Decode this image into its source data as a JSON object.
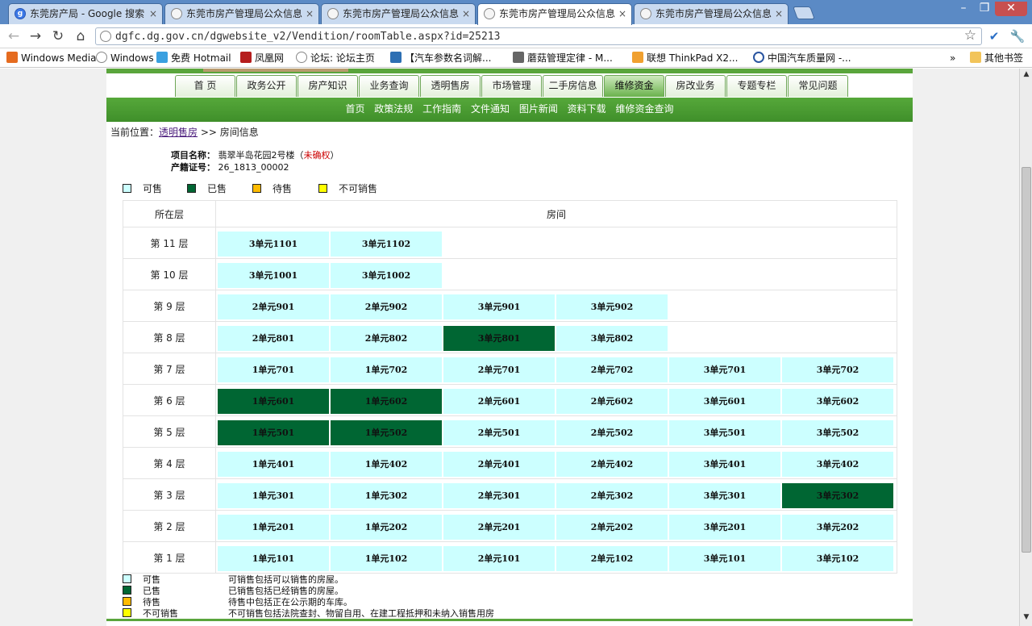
{
  "browser": {
    "tabs": [
      {
        "title": "东莞房产局 - Google 搜索",
        "icon": "google-icon",
        "active": false
      },
      {
        "title": "东莞市房产管理局公众信息",
        "icon": "page-icon",
        "active": false
      },
      {
        "title": "东莞市房产管理局公众信息",
        "icon": "page-icon",
        "active": false
      },
      {
        "title": "东莞市房产管理局公众信息",
        "icon": "page-icon",
        "active": true
      },
      {
        "title": "东莞市房产管理局公众信息",
        "icon": "page-icon",
        "active": false
      }
    ],
    "close_glyph": "×",
    "url": "dgfc.dg.gov.cn/dgwebsite_v2/Vendition/roomTable.aspx?id=25213",
    "bookmarks": [
      "Windows Media",
      "Windows",
      "免费 Hotmail",
      "凤凰网",
      "论坛: 论坛主页",
      "【汽车参数名词解...",
      "蘑菇管理定律 - M...",
      "联想 ThinkPad X2...",
      "中国汽车质量网 -..."
    ],
    "other_bookmarks": "其他书签",
    "overflow": "»"
  },
  "site": {
    "main_nav": [
      "首 页",
      "政务公开",
      "房产知识",
      "业务查询",
      "透明售房",
      "市场管理",
      "二手房信息",
      "维修资金",
      "房改业务",
      "专题专栏",
      "常见问题"
    ],
    "main_nav_active": "维修资金",
    "sub_nav": [
      "首页",
      "政策法规",
      "工作指南",
      "文件通知",
      "图片新闻",
      "资料下载",
      "维修资金查询"
    ],
    "breadcrumb": {
      "prefix": "当前位置：",
      "link": "透明售房",
      "sep": ">>",
      "current": "房间信息"
    },
    "project": {
      "name_label": "项目名称：",
      "name_value": "翡翠半岛花园2号楼",
      "status_open": "（",
      "status": "未确权",
      "status_close": "）",
      "cert_label": "产籍证号：",
      "cert_value": "26_1813_00002"
    },
    "legend": [
      {
        "label": "可售",
        "color": "#ccffff",
        "desc": "可销售包括可以销售的房屋。"
      },
      {
        "label": "已售",
        "color": "#006633",
        "desc": "已销售包括已经销售的房屋。"
      },
      {
        "label": "待售",
        "color": "#ffbb00",
        "desc": "待售中包括正在公示期的车库。"
      },
      {
        "label": "不可销售",
        "color": "#ffff00",
        "desc": "不可销售包括法院查封、物留自用、在建工程抵押和未纳入销售用房"
      }
    ],
    "table": {
      "col_floor": "所在层",
      "col_rooms": "房间",
      "floors": [
        {
          "label": "第 11 层",
          "rooms": [
            {
              "name": "3单元1101",
              "status": "avail"
            },
            {
              "name": "3单元1102",
              "status": "avail"
            }
          ]
        },
        {
          "label": "第 10 层",
          "rooms": [
            {
              "name": "3单元1001",
              "status": "avail"
            },
            {
              "name": "3单元1002",
              "status": "avail"
            }
          ]
        },
        {
          "label": "第 9 层",
          "rooms": [
            {
              "name": "2单元901",
              "status": "avail"
            },
            {
              "name": "2单元902",
              "status": "avail"
            },
            {
              "name": "3单元901",
              "status": "avail"
            },
            {
              "name": "3单元902",
              "status": "avail"
            }
          ]
        },
        {
          "label": "第 8 层",
          "rooms": [
            {
              "name": "2单元801",
              "status": "avail"
            },
            {
              "name": "2单元802",
              "status": "avail"
            },
            {
              "name": "3单元801",
              "status": "sold"
            },
            {
              "name": "3单元802",
              "status": "avail"
            }
          ]
        },
        {
          "label": "第 7 层",
          "rooms": [
            {
              "name": "1单元701",
              "status": "avail"
            },
            {
              "name": "1单元702",
              "status": "avail"
            },
            {
              "name": "2单元701",
              "status": "avail"
            },
            {
              "name": "2单元702",
              "status": "avail"
            },
            {
              "name": "3单元701",
              "status": "avail"
            },
            {
              "name": "3单元702",
              "status": "avail"
            }
          ]
        },
        {
          "label": "第 6 层",
          "rooms": [
            {
              "name": "1单元601",
              "status": "sold"
            },
            {
              "name": "1单元602",
              "status": "sold"
            },
            {
              "name": "2单元601",
              "status": "avail"
            },
            {
              "name": "2单元602",
              "status": "avail"
            },
            {
              "name": "3单元601",
              "status": "avail"
            },
            {
              "name": "3单元602",
              "status": "avail"
            }
          ]
        },
        {
          "label": "第 5 层",
          "rooms": [
            {
              "name": "1单元501",
              "status": "sold"
            },
            {
              "name": "1单元502",
              "status": "sold"
            },
            {
              "name": "2单元501",
              "status": "avail"
            },
            {
              "name": "2单元502",
              "status": "avail"
            },
            {
              "name": "3单元501",
              "status": "avail"
            },
            {
              "name": "3单元502",
              "status": "avail"
            }
          ]
        },
        {
          "label": "第 4 层",
          "rooms": [
            {
              "name": "1单元401",
              "status": "avail"
            },
            {
              "name": "1单元402",
              "status": "avail"
            },
            {
              "name": "2单元401",
              "status": "avail"
            },
            {
              "name": "2单元402",
              "status": "avail"
            },
            {
              "name": "3单元401",
              "status": "avail"
            },
            {
              "name": "3单元402",
              "status": "avail"
            }
          ]
        },
        {
          "label": "第 3 层",
          "rooms": [
            {
              "name": "1单元301",
              "status": "avail"
            },
            {
              "name": "1单元302",
              "status": "avail"
            },
            {
              "name": "2单元301",
              "status": "avail"
            },
            {
              "name": "2单元302",
              "status": "avail"
            },
            {
              "name": "3单元301",
              "status": "avail"
            },
            {
              "name": "3单元302",
              "status": "sold"
            }
          ]
        },
        {
          "label": "第 2 层",
          "rooms": [
            {
              "name": "1单元201",
              "status": "avail"
            },
            {
              "name": "1单元202",
              "status": "avail"
            },
            {
              "name": "2单元201",
              "status": "avail"
            },
            {
              "name": "2单元202",
              "status": "avail"
            },
            {
              "name": "3单元201",
              "status": "avail"
            },
            {
              "name": "3单元202",
              "status": "avail"
            }
          ]
        },
        {
          "label": "第 1 层",
          "rooms": [
            {
              "name": "1单元101",
              "status": "avail"
            },
            {
              "name": "1单元102",
              "status": "avail"
            },
            {
              "name": "2单元101",
              "status": "avail"
            },
            {
              "name": "2单元102",
              "status": "avail"
            },
            {
              "name": "3单元101",
              "status": "avail"
            },
            {
              "name": "3单元102",
              "status": "avail"
            }
          ]
        }
      ]
    }
  }
}
